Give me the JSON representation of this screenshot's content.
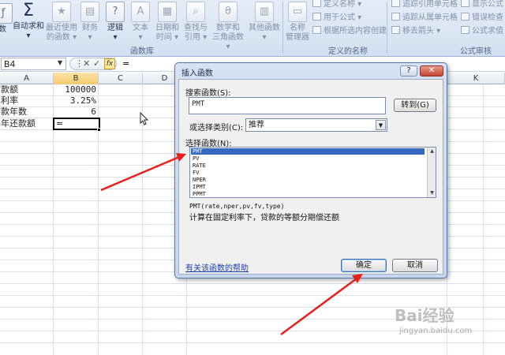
{
  "ribbon": {
    "buttons": [
      {
        "label1": "数",
        "label2": ""
      },
      {
        "label1": "自动求和",
        "label2": "▾"
      },
      {
        "label1": "最近使用",
        "label2": "的函数 ▾"
      },
      {
        "label1": "财务",
        "label2": "▾"
      },
      {
        "label1": "逻辑",
        "label2": "▾"
      },
      {
        "label1": "文本",
        "label2": "▾"
      },
      {
        "label1": "日期和",
        "label2": "时间 ▾"
      },
      {
        "label1": "查找与",
        "label2": "引用 ▾"
      },
      {
        "label1": "数学和",
        "label2": "三角函数 ▾"
      },
      {
        "label1": "其他函数",
        "label2": "▾"
      },
      {
        "label1": "名称",
        "label2": "管理器"
      }
    ],
    "name_small_items": [
      "定义名称 ▾",
      "用于公式 ▾",
      "根据所选内容创建"
    ],
    "audit_small_items": [
      "追踪引用单元格",
      "追踪从属单元格",
      "移去箭头 ▾",
      "显示公式",
      "错误检查 ▾",
      "公式求值"
    ],
    "group_labels": {
      "library": "函数库",
      "names": "定义的名称",
      "audit": "公式审核"
    }
  },
  "formula_bar": {
    "name_box": "B4",
    "cancel_glyph": "✕",
    "enter_glyph": "✓",
    "fx_glyph": "fx",
    "content": "="
  },
  "grid": {
    "columns": [
      "A",
      "B",
      "C",
      "D",
      "K"
    ],
    "cells": {
      "a1": "贷款额",
      "b1": "100000",
      "a2": "年利率",
      "b2": "3.25%",
      "a3": "贷款年数",
      "b3": "6",
      "a4": "每年还款额",
      "b4": "="
    }
  },
  "dialog": {
    "title": "插入函数",
    "help_button": "?",
    "close_button": "✕",
    "search_label": "搜索函数(S):",
    "search_value": "PMT",
    "goto_button": "转到(G)",
    "category_label": "或选择类别(C):",
    "category_value": "推荐",
    "functions_label": "选择函数(N):",
    "functions": [
      "PMT",
      "PV",
      "RATE",
      "FV",
      "NPER",
      "IPMT",
      "PPMT"
    ],
    "syntax": "PMT(rate,nper,pv,fv,type)",
    "description": "计算在固定利率下，贷款的等额分期偿还额",
    "help_link": "有关该函数的帮助",
    "ok_button": "确定",
    "cancel_button": "取消"
  },
  "watermark": {
    "text": "Bai经验",
    "url": "jingyan.baidu.com"
  },
  "colors": {
    "arrow": "#e8201c",
    "selection": "#3567c4",
    "active_header": "#f5c96d"
  }
}
